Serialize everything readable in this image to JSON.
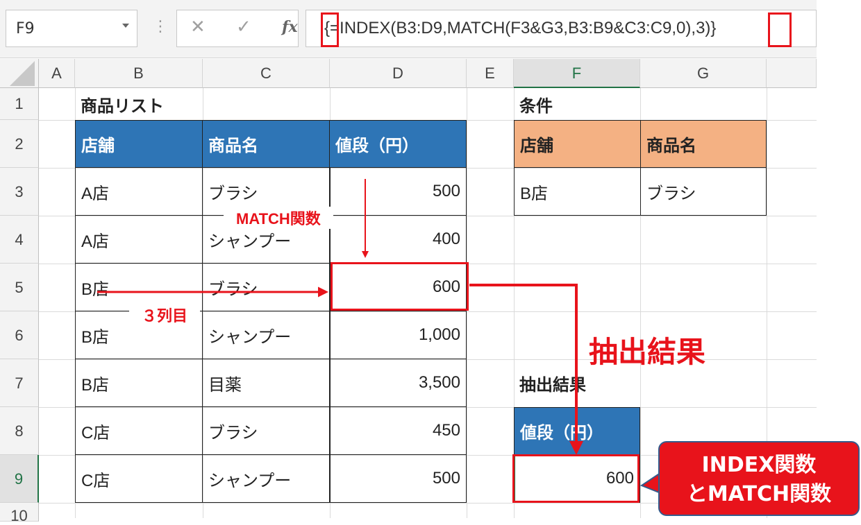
{
  "formula_bar": {
    "name_box": "F9",
    "cancel_icon": "✕",
    "enter_icon": "✓",
    "fx_label": "fx",
    "formula": "{=INDEX(B3:D9,MATCH(F3&G3,B3:B9&C3:C9,0),3)}"
  },
  "columns": [
    "A",
    "B",
    "C",
    "D",
    "E",
    "F",
    "G"
  ],
  "rows": [
    "1",
    "2",
    "3",
    "4",
    "5",
    "6",
    "7",
    "8",
    "9",
    "10"
  ],
  "sheet": {
    "b1": "商品リスト",
    "product_table": {
      "headers": [
        "店舗",
        "商品名",
        "値段（円）"
      ],
      "rows": [
        [
          "A店",
          "ブラシ",
          "500"
        ],
        [
          "A店",
          "シャンプー",
          "400"
        ],
        [
          "B店",
          "ブラシ",
          "600"
        ],
        [
          "B店",
          "シャンプー",
          "1,000"
        ],
        [
          "B店",
          "目薬",
          "3,500"
        ],
        [
          "C店",
          "ブラシ",
          "450"
        ],
        [
          "C店",
          "シャンプー",
          "500"
        ]
      ]
    },
    "f1": "条件",
    "condition_table": {
      "headers": [
        "店舗",
        "商品名"
      ],
      "values": [
        "B店",
        "ブラシ"
      ]
    },
    "f7": "抽出結果",
    "result_header": "値段（円）",
    "result_value": "600"
  },
  "annotations": {
    "match_label": "MATCH関数",
    "column_label": "３列目",
    "extract_label": "抽出結果",
    "bubble_line1": "INDEX関数",
    "bubble_line2": "とMATCH関数"
  },
  "colors": {
    "header_blue": "#2e75b6",
    "header_orange": "#f4b183",
    "annotation_red": "#e8131b"
  }
}
